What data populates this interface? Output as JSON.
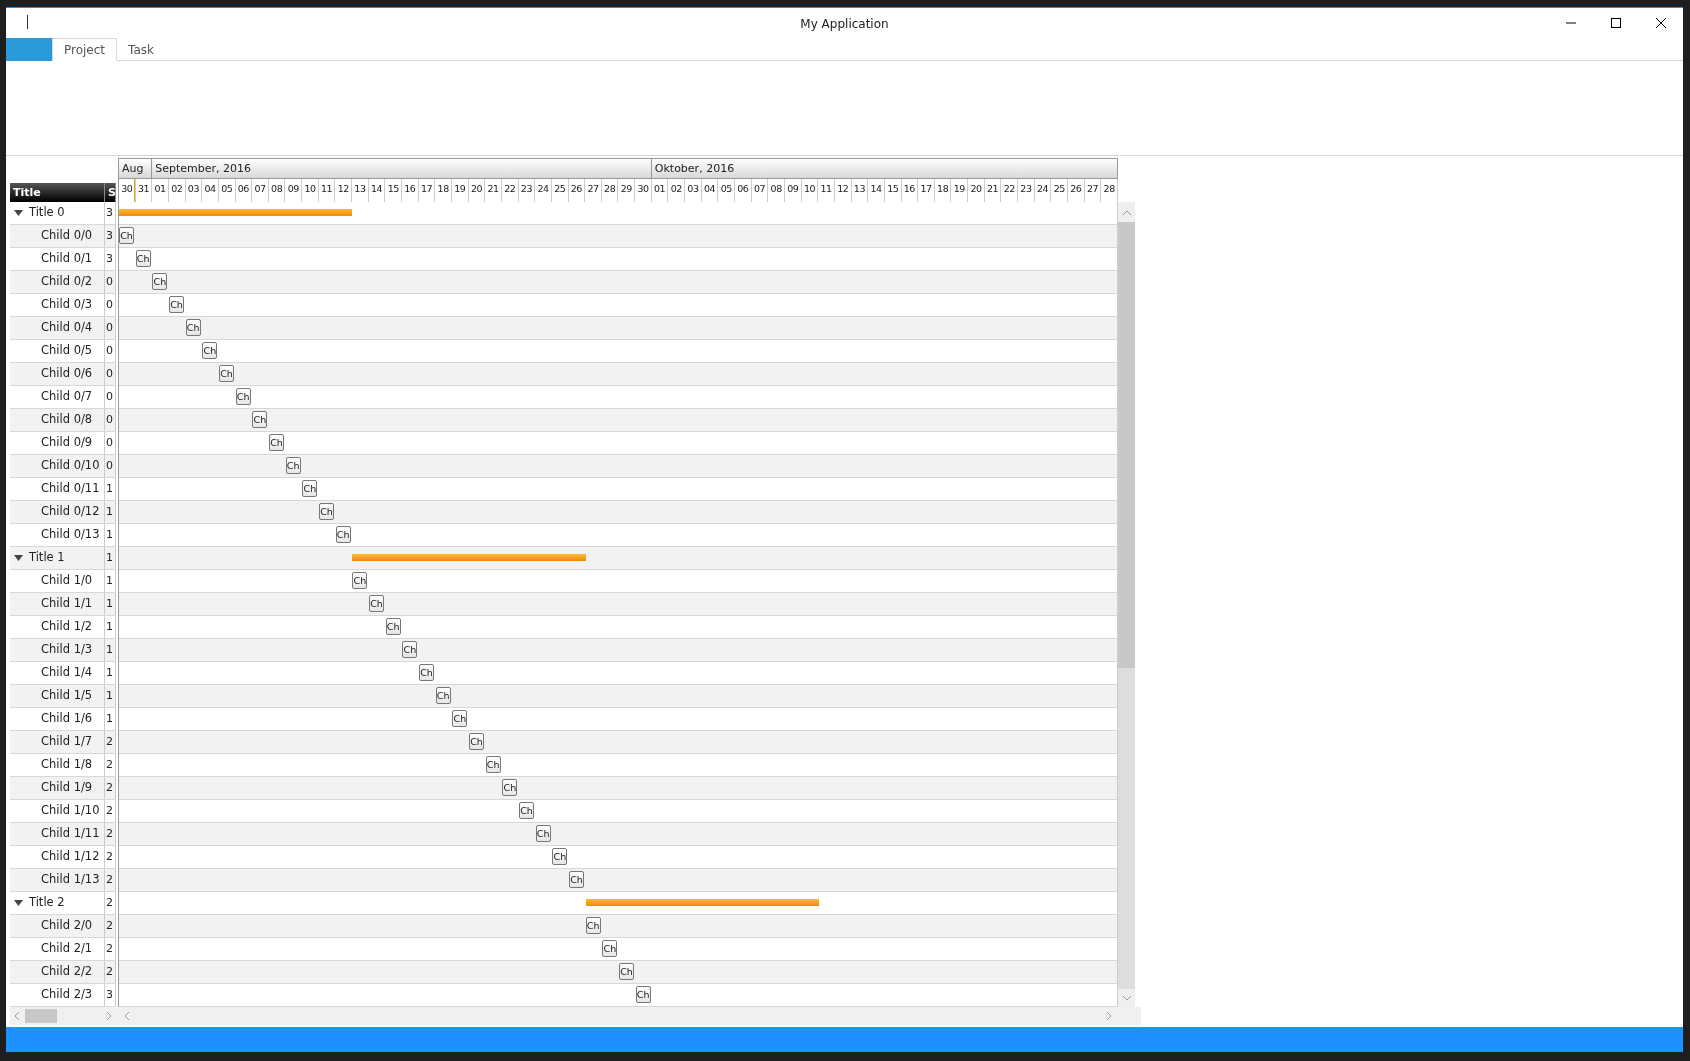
{
  "window": {
    "title": "My Application"
  },
  "ribbon": {
    "tabs": [
      {
        "kind": "app_menu",
        "selected": false
      },
      {
        "kind": "tab",
        "label": "Project",
        "selected": true
      },
      {
        "kind": "tab",
        "label": "Task",
        "selected": false
      }
    ]
  },
  "gantt": {
    "columns": [
      "Title",
      "S"
    ],
    "timeline": {
      "months": [
        {
          "label": "Aug",
          "days": [
            "30",
            "31"
          ]
        },
        {
          "label": "September, 2016",
          "days": [
            "01",
            "02",
            "03",
            "04",
            "05",
            "06",
            "07",
            "08",
            "09",
            "10",
            "11",
            "12",
            "13",
            "14",
            "15",
            "16",
            "17",
            "18",
            "19",
            "20",
            "21",
            "22",
            "23",
            "24",
            "25",
            "26",
            "27",
            "28",
            "29",
            "30"
          ]
        },
        {
          "label": "Oktober, 2016",
          "days": [
            "01",
            "02",
            "03",
            "04",
            "05",
            "06",
            "07",
            "08",
            "09",
            "10",
            "11",
            "12",
            "13",
            "14",
            "15",
            "16",
            "17",
            "18",
            "19",
            "20",
            "21",
            "22",
            "23",
            "24",
            "25",
            "26",
            "27",
            "28"
          ]
        }
      ]
    },
    "rows": [
      {
        "title": "Title 0",
        "s": "3",
        "expanded": true,
        "children": [
          {
            "title": "Child 0/0",
            "s": "3",
            "bar_label": "Ch"
          },
          {
            "title": "Child 0/1",
            "s": "3",
            "bar_label": "Ch"
          },
          {
            "title": "Child 0/2",
            "s": "0",
            "bar_label": "Ch"
          },
          {
            "title": "Child 0/3",
            "s": "0",
            "bar_label": "Ch"
          },
          {
            "title": "Child 0/4",
            "s": "0",
            "bar_label": "Ch"
          },
          {
            "title": "Child 0/5",
            "s": "0",
            "bar_label": "Ch"
          },
          {
            "title": "Child 0/6",
            "s": "0",
            "bar_label": "Ch"
          },
          {
            "title": "Child 0/7",
            "s": "0",
            "bar_label": "Ch"
          },
          {
            "title": "Child 0/8",
            "s": "0",
            "bar_label": "Ch"
          },
          {
            "title": "Child 0/9",
            "s": "0",
            "bar_label": "Ch"
          },
          {
            "title": "Child 0/10",
            "s": "0",
            "bar_label": "Ch"
          },
          {
            "title": "Child 0/11",
            "s": "1",
            "bar_label": "Ch"
          },
          {
            "title": "Child 0/12",
            "s": "1",
            "bar_label": "Ch"
          },
          {
            "title": "Child 0/13",
            "s": "1",
            "bar_label": "Ch"
          }
        ]
      },
      {
        "title": "Title 1",
        "s": "1",
        "expanded": true,
        "children": [
          {
            "title": "Child 1/0",
            "s": "1",
            "bar_label": "Ch"
          },
          {
            "title": "Child 1/1",
            "s": "1",
            "bar_label": "Ch"
          },
          {
            "title": "Child 1/2",
            "s": "1",
            "bar_label": "Ch"
          },
          {
            "title": "Child 1/3",
            "s": "1",
            "bar_label": "Ch"
          },
          {
            "title": "Child 1/4",
            "s": "1",
            "bar_label": "Ch"
          },
          {
            "title": "Child 1/5",
            "s": "1",
            "bar_label": "Ch"
          },
          {
            "title": "Child 1/6",
            "s": "1",
            "bar_label": "Ch"
          },
          {
            "title": "Child 1/7",
            "s": "2",
            "bar_label": "Ch"
          },
          {
            "title": "Child 1/8",
            "s": "2",
            "bar_label": "Ch"
          },
          {
            "title": "Child 1/9",
            "s": "2",
            "bar_label": "Ch"
          },
          {
            "title": "Child 1/10",
            "s": "2",
            "bar_label": "Ch"
          },
          {
            "title": "Child 1/11",
            "s": "2",
            "bar_label": "Ch"
          },
          {
            "title": "Child 1/12",
            "s": "2",
            "bar_label": "Ch"
          },
          {
            "title": "Child 1/13",
            "s": "2",
            "bar_label": "Ch"
          }
        ]
      },
      {
        "title": "Title 2",
        "s": "2",
        "expanded": true,
        "children": [
          {
            "title": "Child 2/0",
            "s": "2",
            "bar_label": "Ch"
          },
          {
            "title": "Child 2/1",
            "s": "2",
            "bar_label": "Ch"
          },
          {
            "title": "Child 2/2",
            "s": "2",
            "bar_label": "Ch"
          },
          {
            "title": "Child 2/3",
            "s": "3",
            "bar_label": "Ch"
          }
        ]
      }
    ]
  }
}
